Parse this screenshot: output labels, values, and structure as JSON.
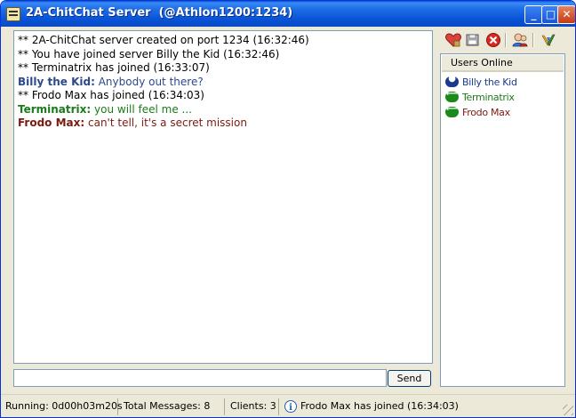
{
  "window": {
    "title": "2A-ChitChat Server  (@Athlon1200:1234)",
    "buttons": {
      "minimize": "_",
      "maximize": "□",
      "close": "✕"
    }
  },
  "chat": {
    "messages": [
      {
        "type": "system",
        "text": "** 2A-ChitChat server created on port 1234 (16:32:46)"
      },
      {
        "type": "system",
        "text": "** You have joined server Billy the Kid (16:32:46)"
      },
      {
        "type": "system",
        "text": "** Terminatrix has joined (16:33:07)"
      },
      {
        "type": "chat",
        "nick": "Billy the Kid:",
        "text": " Anybody out there?",
        "color": "#2a4a8a"
      },
      {
        "type": "system",
        "text": "** Frodo Max has joined (16:34:03)"
      },
      {
        "type": "chat",
        "nick": "Terminatrix:",
        "text": " you will feel me ...",
        "color": "#1b7a1b"
      },
      {
        "type": "chat",
        "nick": "Frodo Max:",
        "text": " can't tell, it's a secret mission",
        "color": "#7a1a10"
      }
    ],
    "input_value": "",
    "send_label": "Send"
  },
  "toolbar": {
    "icons": [
      "heart-icon",
      "disk-icon",
      "stop-icon",
      "users-icon",
      "chart-icon"
    ]
  },
  "users_panel": {
    "header": "Users Online",
    "users": [
      {
        "name": "Billy the Kid",
        "color": "#1a3a8a",
        "icon": "user-self-icon",
        "badge_color": "#1a3a8a"
      },
      {
        "name": "Terminatrix",
        "color": "#1b7a1b",
        "icon": "user-arrow-icon",
        "badge_color": "#1b8a1b"
      },
      {
        "name": "Frodo Max",
        "color": "#7a1a10",
        "icon": "user-arrow-icon",
        "badge_color": "#1b8a1b"
      }
    ]
  },
  "statusbar": {
    "running": "Running: 0d00h03m20s",
    "total_messages": "Total Messages: 8",
    "clients": "Clients: 3",
    "last_event": "Frodo Max has joined (16:34:03)"
  }
}
